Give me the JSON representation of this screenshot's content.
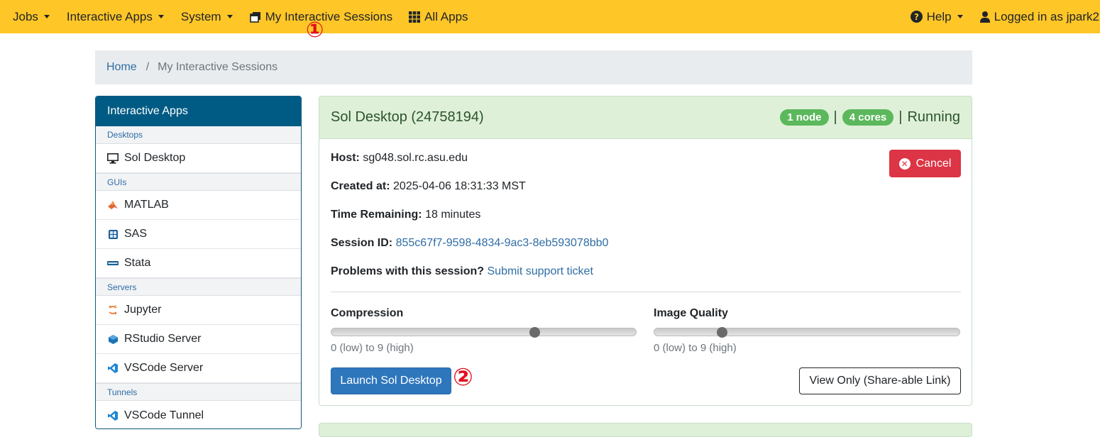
{
  "navbar": {
    "jobs": "Jobs",
    "interactive_apps": "Interactive Apps",
    "system": "System",
    "my_sessions": "My Interactive Sessions",
    "all_apps": "All Apps",
    "help": "Help",
    "user": "Logged in as jpark2"
  },
  "breadcrumb": {
    "home": "Home",
    "separator": "/",
    "current": "My Interactive Sessions"
  },
  "sidebar": {
    "title": "Interactive Apps",
    "categories": [
      "Desktops",
      "GUIs",
      "Servers",
      "Tunnels"
    ],
    "items": [
      "Sol Desktop",
      "MATLAB",
      "SAS",
      "Stata",
      "Jupyter",
      "RStudio Server",
      "VSCode Server",
      "VSCode Tunnel"
    ]
  },
  "session": {
    "title": "Sol Desktop (24758194)",
    "nodes_badge": "1 node",
    "cores_badge": "4 cores",
    "separator": "|",
    "status": "Running",
    "host_label": "Host:",
    "host_value": "sg048.sol.rc.asu.edu",
    "created_label": "Created at:",
    "created_value": "2025-04-06 18:31:33 MST",
    "remaining_label": "Time Remaining:",
    "remaining_value": "18 minutes",
    "session_id_label": "Session ID:",
    "session_id_value": "855c67f7-9598-4834-9ac3-8eb593078bb0",
    "problems_label": "Problems with this session?",
    "support_link": "Submit support ticket",
    "cancel_label": "Cancel",
    "compression_label": "Compression",
    "compression_value": 6,
    "quality_label": "Image Quality",
    "quality_value": 2,
    "slider_help": "0 (low) to 9 (high)",
    "launch_label": "Launch Sol Desktop",
    "view_only_label": "View Only (Share-able Link)"
  },
  "annotations": [
    "①",
    "②"
  ],
  "colors": {
    "navbar": "#ffc627",
    "sidebar_header": "#005b84",
    "card_header": "#dff0d8",
    "badge": "#5cb85c",
    "cancel": "#dc3545",
    "launch": "#2e77bd",
    "link": "#2e6da4"
  }
}
